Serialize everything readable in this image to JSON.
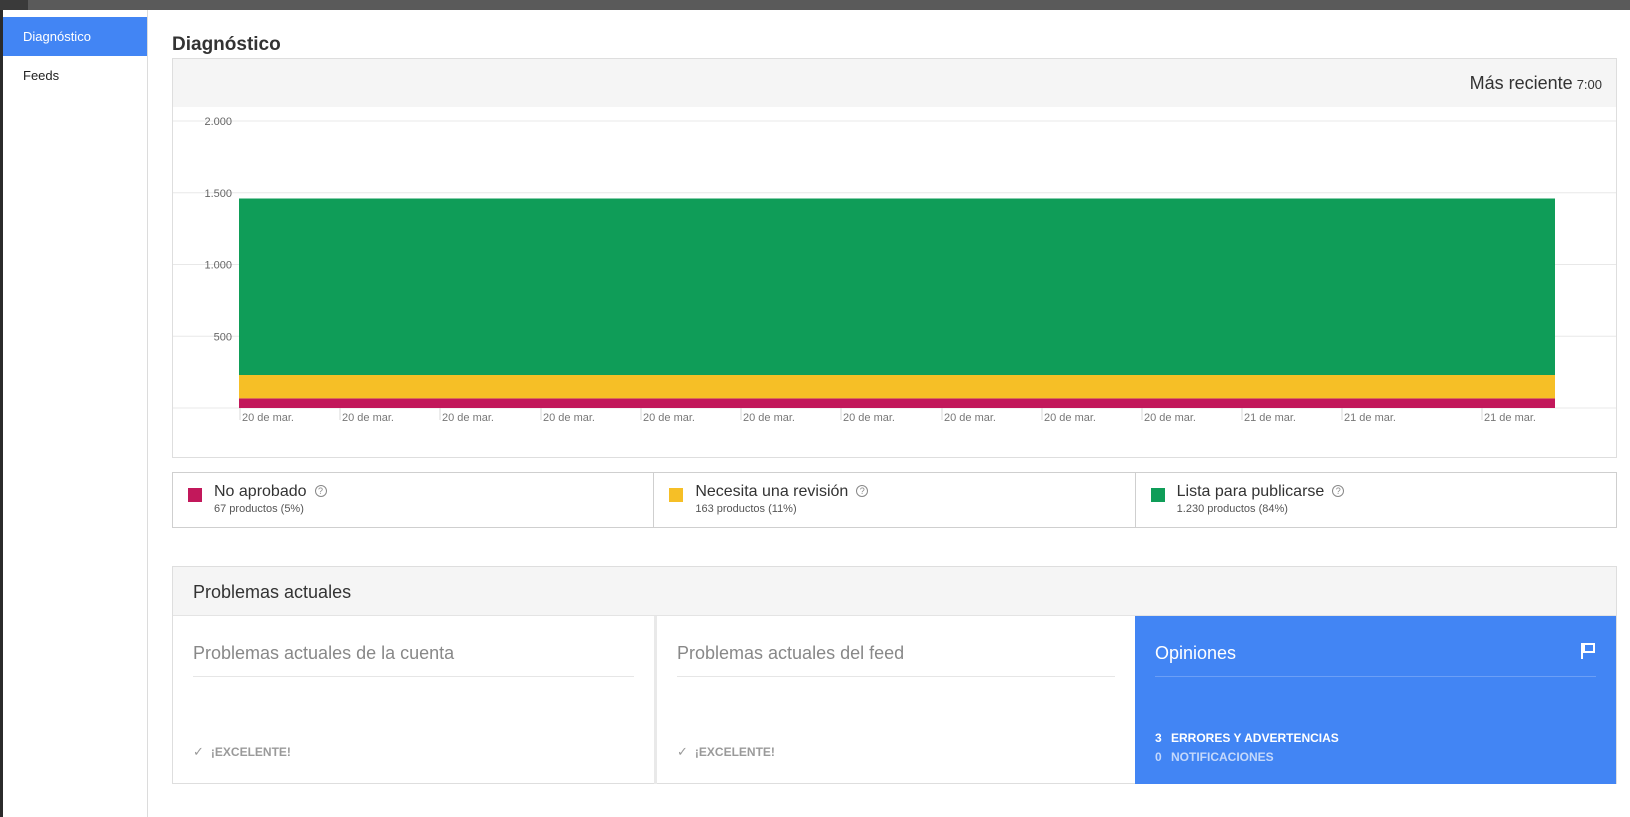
{
  "sidebar": {
    "items": [
      {
        "label": "Diagnóstico",
        "active": true
      },
      {
        "label": "Feeds",
        "active": false
      }
    ]
  },
  "page": {
    "title": "Diagnóstico"
  },
  "chart_header": {
    "label": "Más reciente",
    "time": "7:00"
  },
  "chart_data": {
    "type": "area",
    "stacked": true,
    "title": "",
    "xlabel": "",
    "ylabel": "",
    "ylim": [
      0,
      2000
    ],
    "y_ticks": [
      "500",
      "1.000",
      "1.500",
      "2.000"
    ],
    "categories": [
      "20 de mar.",
      "20 de mar.",
      "20 de mar.",
      "20 de mar.",
      "20 de mar.",
      "20 de mar.",
      "20 de mar.",
      "20 de mar.",
      "20 de mar.",
      "20 de mar.",
      "21 de mar.",
      "21 de mar.",
      "21 de mar."
    ],
    "series": [
      {
        "name": "No aprobado",
        "color": "#c2185b",
        "values": [
          67,
          67,
          67,
          67,
          67,
          67,
          67,
          67,
          67,
          67,
          67,
          67,
          67
        ]
      },
      {
        "name": "Necesita una revisión",
        "color": "#f6bf26",
        "values": [
          163,
          163,
          163,
          163,
          163,
          163,
          163,
          163,
          163,
          163,
          163,
          163,
          163
        ]
      },
      {
        "name": "Lista para publicarse",
        "color": "#0f9d58",
        "values": [
          1230,
          1230,
          1230,
          1230,
          1230,
          1230,
          1230,
          1230,
          1230,
          1230,
          1230,
          1230,
          1230
        ]
      }
    ],
    "grid": true,
    "legend": "bottom"
  },
  "legend": {
    "items": [
      {
        "label": "No aprobado",
        "sub": "67 productos (5%)",
        "color": "#c2185b"
      },
      {
        "label": "Necesita una revisión",
        "sub": "163 productos (11%)",
        "color": "#f6bf26"
      },
      {
        "label": "Lista para publicarse",
        "sub": "1.230 productos (84%)",
        "color": "#0f9d58"
      }
    ]
  },
  "issues": {
    "title": "Problemas actuales",
    "account": {
      "title": "Problemas actuales de la cuenta",
      "status": "¡EXCELENTE!"
    },
    "feed": {
      "title": "Problemas actuales del feed",
      "status": "¡EXCELENTE!"
    },
    "opinions": {
      "title": "Opiniones",
      "errors_count": "3",
      "errors_label": "ERRORES Y ADVERTENCIAS",
      "notifs_count": "0",
      "notifs_label": "NOTIFICACIONES"
    }
  },
  "icons": {
    "help": "?",
    "check": "✓",
    "flag": "flag-icon"
  },
  "colors": {
    "accent": "#4285f4"
  }
}
